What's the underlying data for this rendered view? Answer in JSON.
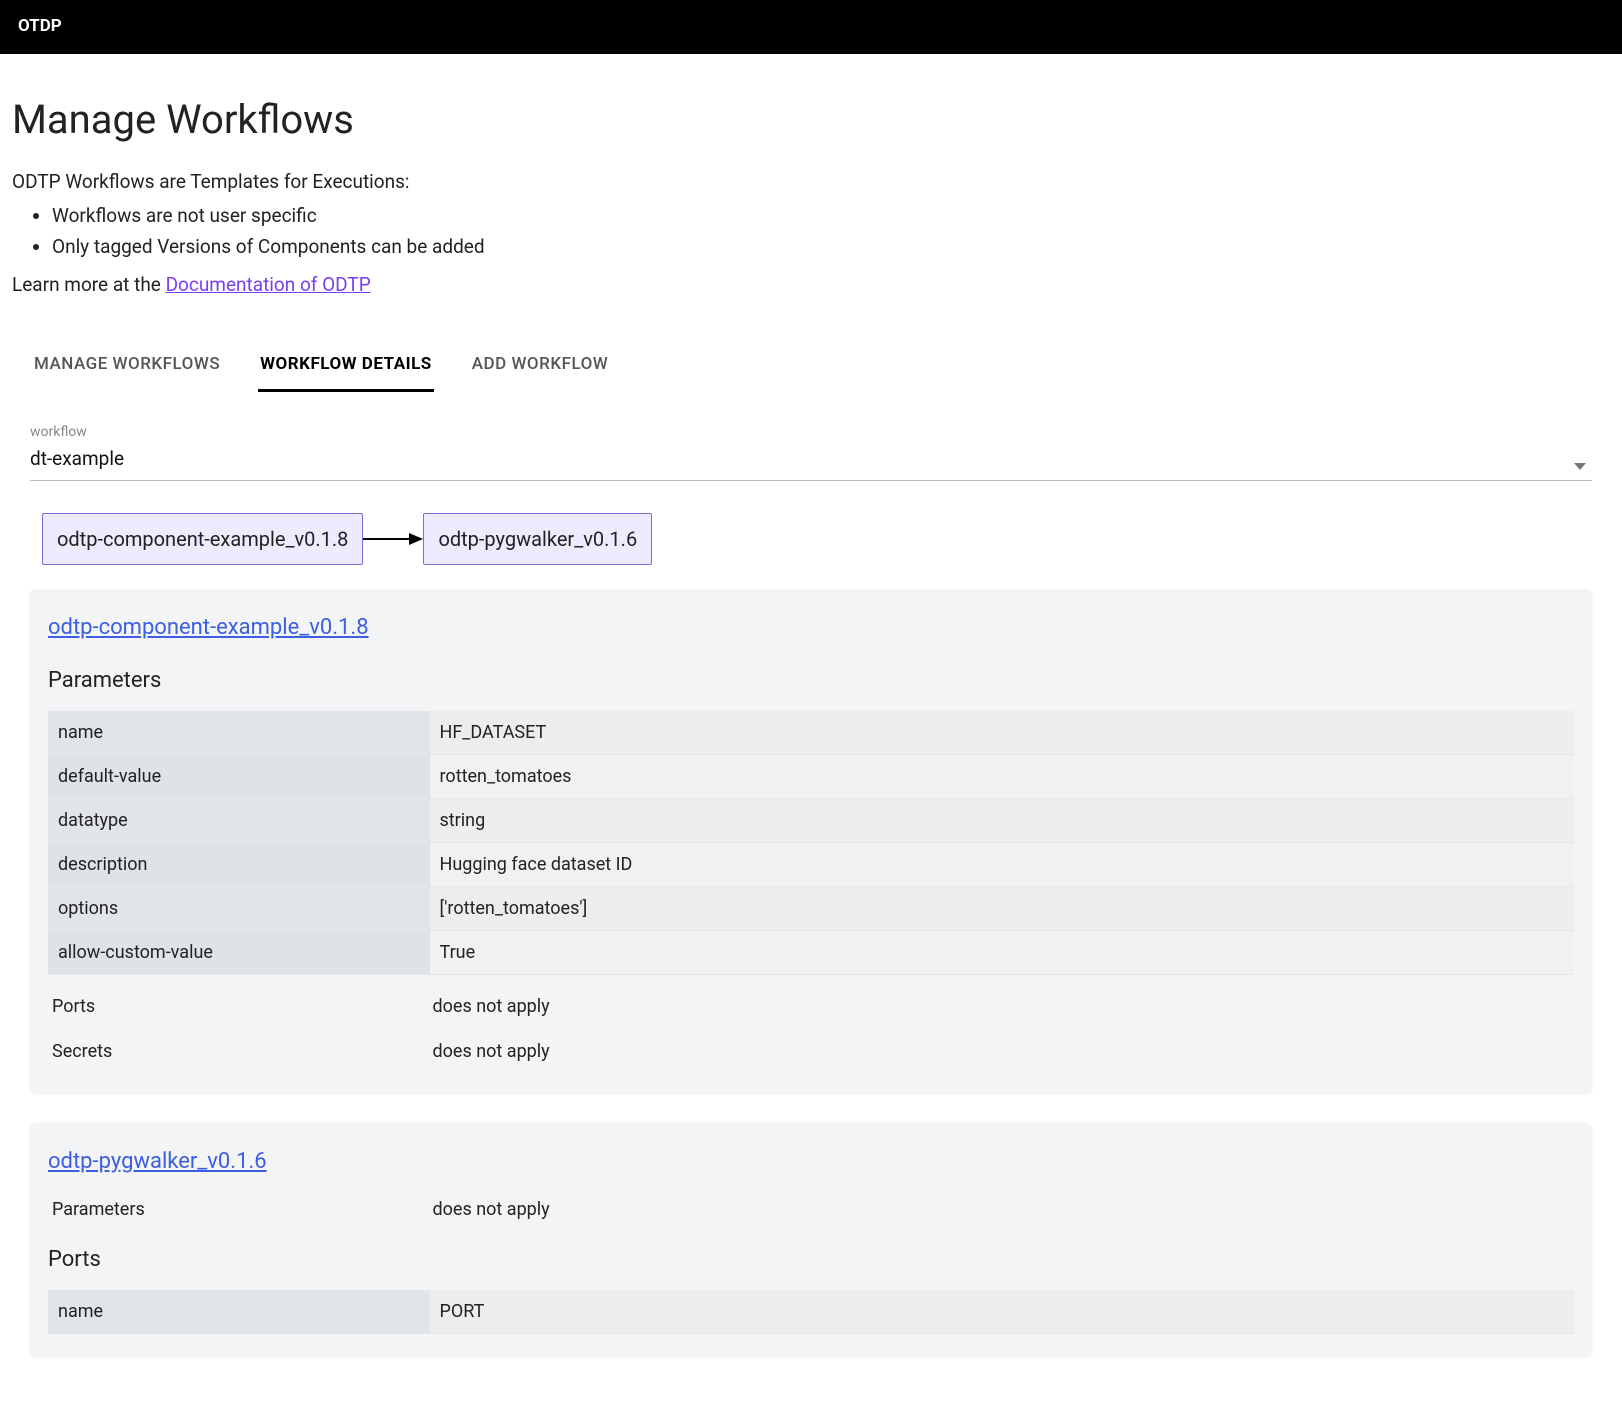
{
  "header": {
    "brand": "OTDP"
  },
  "page": {
    "title": "Manage Workflows",
    "intro": "ODTP Workflows are Templates for Executions:",
    "bullets": [
      "Workflows are not user specific",
      "Only tagged Versions of Components can be added"
    ],
    "learn_prefix": "Learn more at the ",
    "doc_link_text": "Documentation of ODTP"
  },
  "tabs": [
    {
      "label": "MANAGE WORKFLOWS",
      "active": false
    },
    {
      "label": "WORKFLOW DETAILS",
      "active": true
    },
    {
      "label": "ADD WORKFLOW",
      "active": false
    }
  ],
  "selector": {
    "label": "workflow",
    "value": "dt-example"
  },
  "diagram": {
    "nodes": [
      "odtp-component-example_v0.1.8",
      "odtp-pygwalker_v0.1.6"
    ]
  },
  "cards": [
    {
      "title": "odtp-component-example_v0.1.8",
      "parameters_heading": "Parameters",
      "parameters": [
        {
          "k": "name",
          "v": "HF_DATASET"
        },
        {
          "k": "default-value",
          "v": "rotten_tomatoes"
        },
        {
          "k": "datatype",
          "v": "string"
        },
        {
          "k": "description",
          "v": "Hugging face dataset ID"
        },
        {
          "k": "options",
          "v": "['rotten_tomatoes']"
        },
        {
          "k": "allow-custom-value",
          "v": "True"
        }
      ],
      "extras": [
        {
          "k": "Ports",
          "v": "does not apply"
        },
        {
          "k": "Secrets",
          "v": "does not apply"
        }
      ]
    },
    {
      "title": "odtp-pygwalker_v0.1.6",
      "pre_extras": [
        {
          "k": "Parameters",
          "v": "does not apply"
        }
      ],
      "ports_heading": "Ports",
      "ports": [
        {
          "k": "name",
          "v": "PORT"
        }
      ]
    }
  ]
}
